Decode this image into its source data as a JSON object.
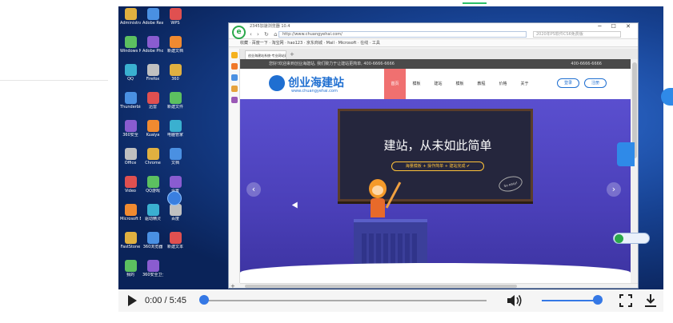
{
  "video": {
    "current_time": "0:00",
    "separator": " / ",
    "duration": "5:45",
    "progress_fraction": 0.0,
    "volume_fraction": 1.0
  },
  "browser": {
    "title": "2345加速浏览器 10.4",
    "url": "http://www.chuangyehai.com/",
    "search_placeholder": "2020年PS软件CS6免费版",
    "bookmarks": "收藏 · 百度一下 · 淘宝网 · hao123 · 京东商城 · Mail · Microsoft · 在线 · 工具",
    "tab_label": "创业海建站系统-专业网站建设",
    "tab_new": "+"
  },
  "site": {
    "top_notice": "您好!欢迎来到创业海建站, 我们致力于让建站更简单, 400-6666-6666",
    "top_right": "400-6666-6666",
    "logo_text": "创业海建站",
    "logo_sub": "www.chuangyehai.com",
    "nav": [
      "首页",
      "模板",
      "建站",
      "模板",
      "教程",
      "价格",
      "关于"
    ],
    "login_label": "登录",
    "register_label": "注册",
    "banner_title": "建站，从未如此简单",
    "banner_pill": "海量模板 + 操作简单 + 建站完成 ✔",
    "banner_note": "So easy!",
    "prev_arrow": "‹",
    "next_arrow": "›"
  },
  "desktop": {
    "icons": [
      "Administrator",
      "Adobe Reader",
      "WPS",
      "Windows Media",
      "Adobe Photoshop",
      "新建文档",
      "QQ",
      "Firefox",
      "360",
      "Thunderbird",
      "迅雷",
      "新建文件",
      "360安全",
      "Kuaiya",
      "电脑管家",
      "Office",
      "Chrome",
      "文档",
      "Video",
      "QQ游戏",
      "设置",
      "Microsoft Edge",
      "驱动精灵",
      "百度",
      "FastStone",
      "360浏览器",
      "新建文本",
      "我的",
      "360安全卫士"
    ]
  },
  "colors": {
    "accent": "#3578e5",
    "banner": "#4a3fb8",
    "nav_active": "#f07070"
  }
}
